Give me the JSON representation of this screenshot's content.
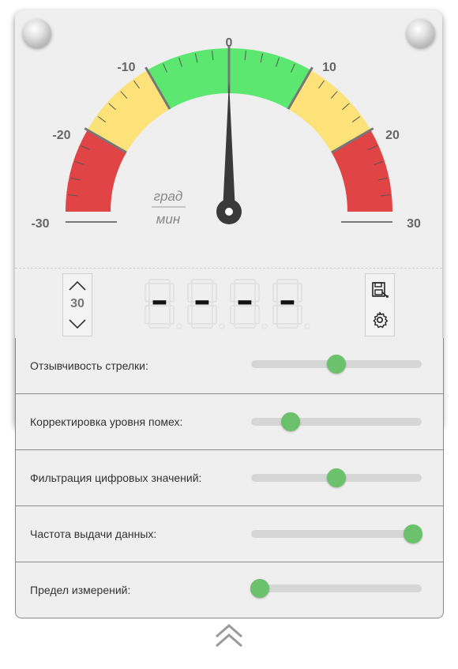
{
  "gauge": {
    "tick_labels": [
      "-30",
      "-20",
      "-10",
      "0",
      "10",
      "20",
      "30"
    ],
    "unit_top": "град",
    "unit_bottom": "мин",
    "min": -30,
    "max": 30,
    "needle_value": 0,
    "zones": [
      {
        "from": -30,
        "to": -20,
        "color": "#e04444"
      },
      {
        "from": -20,
        "to": -10,
        "color": "#fde27a"
      },
      {
        "from": -10,
        "to": 10,
        "color": "#5ce870"
      },
      {
        "from": 10,
        "to": 20,
        "color": "#fde27a"
      },
      {
        "from": 20,
        "to": 30,
        "color": "#e04444"
      }
    ]
  },
  "display": {
    "range_value": "30",
    "digits": [
      "-",
      "-",
      "-",
      "-"
    ],
    "up_icon": "chevron-up-icon",
    "down_icon": "chevron-down-icon",
    "save_icon": "save-icon",
    "settings_icon": "gear-icon"
  },
  "settings": [
    {
      "label": "Отзывчивость стрелки:",
      "value": 0.5
    },
    {
      "label": "Корректировка уровня помех:",
      "value": 0.23
    },
    {
      "label": "Фильтрация цифровых значений:",
      "value": 0.5
    },
    {
      "label": "Частота выдачи данных:",
      "value": 0.95
    },
    {
      "label": "Предел измерений:",
      "value": 0.05
    }
  ],
  "colors": {
    "accent": "#6cc26c",
    "needle": "#3a3a3a"
  },
  "collapse_icon": "double-chevron-up-icon"
}
